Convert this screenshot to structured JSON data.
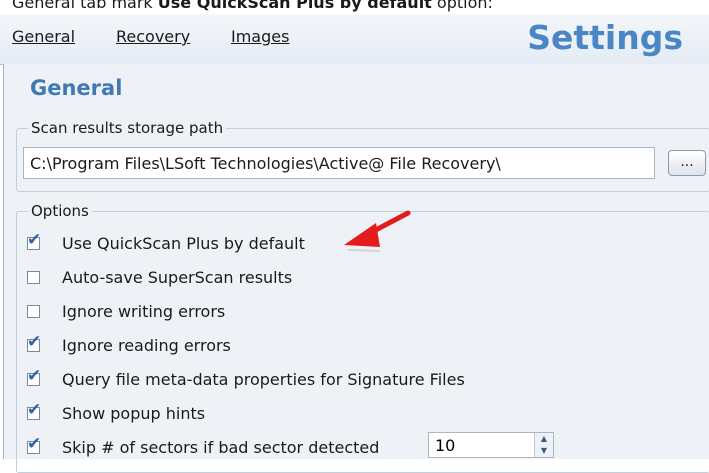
{
  "caption": {
    "prefix": "General tab mark ",
    "bold": "Use QuickScan Plus by default",
    "suffix": " option:"
  },
  "header": {
    "tabs": [
      {
        "label": "General"
      },
      {
        "label": "Recovery"
      },
      {
        "label": "Images"
      }
    ],
    "brand": "Settings"
  },
  "section_title": "General",
  "storage": {
    "title": "Scan results storage path",
    "path_value": "C:\\Program Files\\LSoft Technologies\\Active@ File Recovery\\",
    "browse_label": "..."
  },
  "options": {
    "title": "Options",
    "items": [
      {
        "label": "Use QuickScan Plus by default",
        "checked": true
      },
      {
        "label": "Auto-save SuperScan results",
        "checked": false
      },
      {
        "label": "Ignore writing errors",
        "checked": false
      },
      {
        "label": "Ignore reading errors",
        "checked": true
      },
      {
        "label": "Query file meta-data properties for Signature Files",
        "checked": true
      },
      {
        "label": "Show popup hints",
        "checked": true
      },
      {
        "label": "Skip # of sectors if bad sector detected",
        "checked": true
      }
    ],
    "skip_sectors_value": "10"
  },
  "colors": {
    "accent": "#4a86c5",
    "section_title": "#3f79b3",
    "arrow": "#e31b1b",
    "panel_bg": "#eef2f7"
  }
}
